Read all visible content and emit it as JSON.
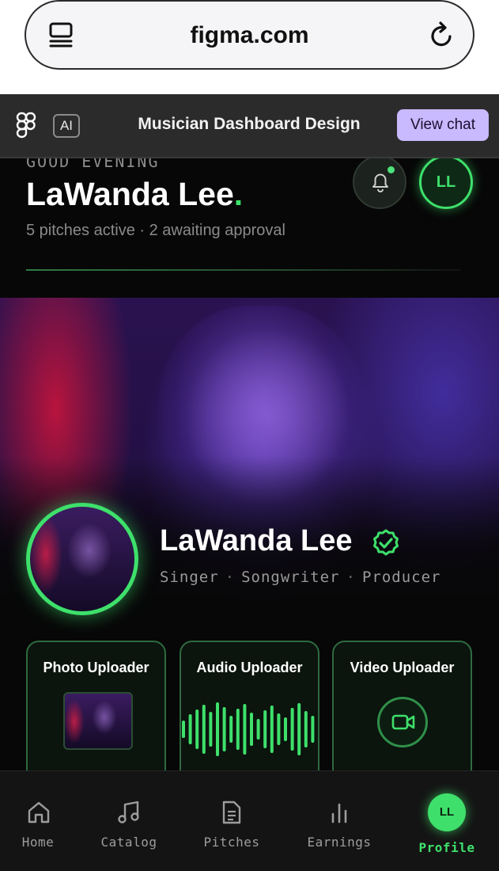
{
  "browser": {
    "url": "figma.com",
    "icons": [
      "tabs-icon",
      "reload-icon"
    ]
  },
  "figma_header": {
    "ai_label": "AI",
    "title": "Musician Dashboard Design",
    "view_chat": "View chat"
  },
  "greeting": {
    "salutation": "GOOD EVENING",
    "name": "LaWanda Lee",
    "dot": ".",
    "summary": "5 pitches active · 2 awaiting approval"
  },
  "top_avatar": "LL",
  "profile": {
    "name": "LaWanda Lee",
    "roles": [
      "Singer",
      "Songwriter",
      "Producer"
    ],
    "role_separator": "·",
    "verified": true
  },
  "uploaders": [
    {
      "title": "Photo Uploader",
      "icon": "photo-thumbnail"
    },
    {
      "title": "Audio Uploader",
      "icon": "waveform-icon"
    },
    {
      "title": "Video Uploader",
      "icon": "video-camera-icon"
    }
  ],
  "bottom_nav": {
    "items": [
      {
        "label": "Home",
        "icon": "home-icon"
      },
      {
        "label": "Catalog",
        "icon": "music-note-icon"
      },
      {
        "label": "Pitches",
        "icon": "document-icon"
      },
      {
        "label": "Earnings",
        "icon": "bar-chart-icon"
      },
      {
        "label": "Profile",
        "avatar": "LL",
        "active": true
      }
    ]
  },
  "colors": {
    "accent": "#3ee06b",
    "view_chat_bg": "#c9b9ff",
    "background": "#070707"
  }
}
